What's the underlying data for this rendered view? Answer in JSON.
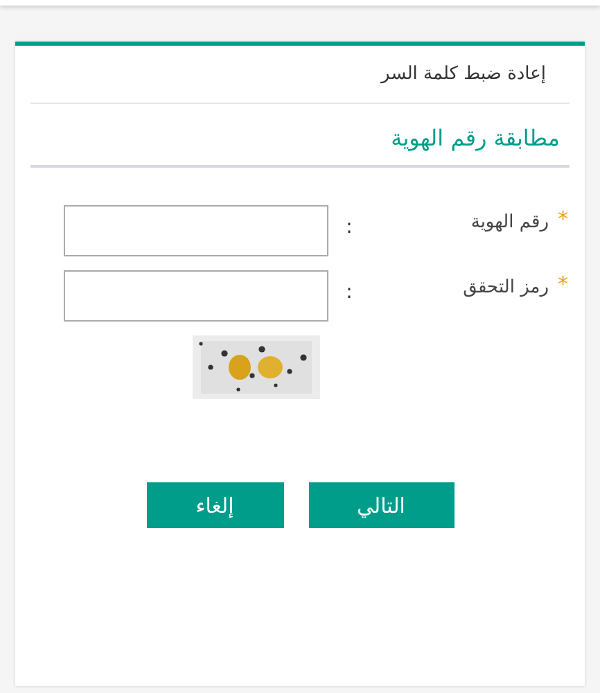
{
  "page": {
    "title": "إعادة ضبط كلمة السر"
  },
  "section": {
    "heading": "مطابقة رقم الهوية"
  },
  "fields": [
    {
      "label": "رقم الهوية",
      "required": true,
      "required_mark": "*",
      "separator": ":"
    },
    {
      "label": "رمز التحقق",
      "required": true,
      "required_mark": "*",
      "separator": ":"
    }
  ],
  "buttons": [
    {
      "label": "التالي"
    },
    {
      "label": "إلغاء"
    }
  ]
}
